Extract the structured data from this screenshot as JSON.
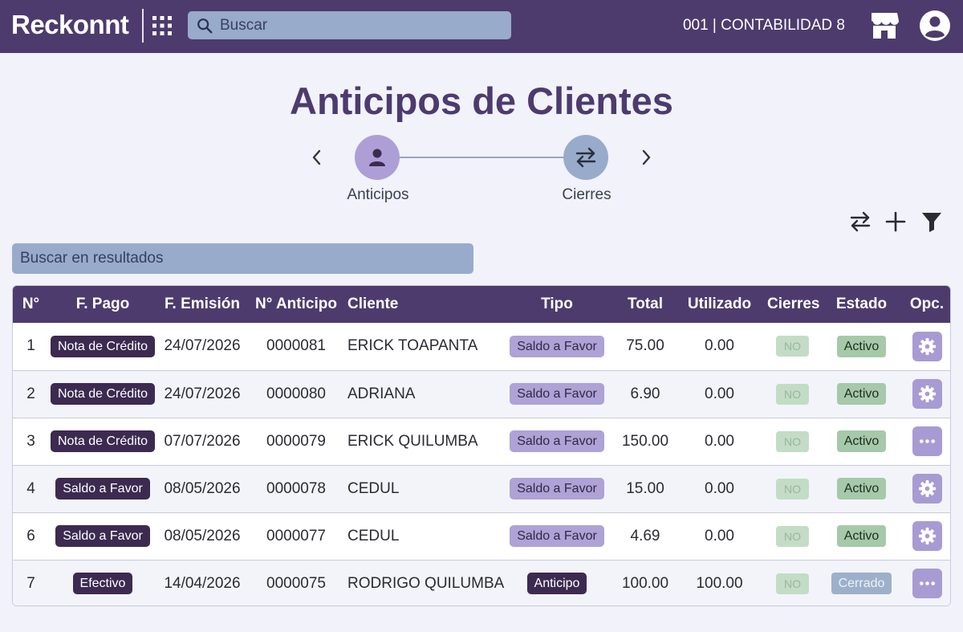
{
  "header": {
    "brand": "Reckonnt",
    "search_placeholder": "Buscar",
    "company": "001 | CONTABILIDAD 8"
  },
  "page": {
    "title": "Anticipos de Clientes"
  },
  "stepper": {
    "steps": [
      {
        "label": "Anticipos",
        "icon": "person-icon"
      },
      {
        "label": "Cierres",
        "icon": "swap-icon"
      }
    ]
  },
  "toolbar": {
    "icons": [
      "swap-icon",
      "plus-icon",
      "filter-icon"
    ]
  },
  "results_search": {
    "placeholder": "Buscar en resultados"
  },
  "table": {
    "columns": [
      "N°",
      "F. Pago",
      "F. Emisión",
      "N° Anticipo",
      "Cliente",
      "Tipo",
      "Total",
      "Utilizado",
      "Cierres",
      "Estado",
      "Opc."
    ],
    "rows": [
      {
        "n": "1",
        "pago": "Nota de Crédito",
        "emision": "24/07/2026",
        "anticipo": "0000081",
        "cliente": "ERICK TOAPANTA",
        "tipo": "Saldo a Favor",
        "total": "75.00",
        "utilizado": "0.00",
        "cierres": "NO",
        "estado": "Activo",
        "opc": "gear-icon"
      },
      {
        "n": "2",
        "pago": "Nota de Crédito",
        "emision": "24/07/2026",
        "anticipo": "0000080",
        "cliente": "ADRIANA",
        "tipo": "Saldo a Favor",
        "total": "6.90",
        "utilizado": "0.00",
        "cierres": "NO",
        "estado": "Activo",
        "opc": "gear-icon"
      },
      {
        "n": "3",
        "pago": "Nota de Crédito",
        "emision": "07/07/2026",
        "anticipo": "0000079",
        "cliente": "ERICK QUILUMBA",
        "tipo": "Saldo a Favor",
        "total": "150.00",
        "utilizado": "0.00",
        "cierres": "NO",
        "estado": "Activo",
        "opc": "more-icon"
      },
      {
        "n": "4",
        "pago": "Saldo a Favor",
        "emision": "08/05/2026",
        "anticipo": "0000078",
        "cliente": "CEDUL",
        "tipo": "Saldo a Favor",
        "total": "15.00",
        "utilizado": "0.00",
        "cierres": "NO",
        "estado": "Activo",
        "opc": "gear-icon"
      },
      {
        "n": "6",
        "pago": "Saldo a Favor",
        "emision": "08/05/2026",
        "anticipo": "0000077",
        "cliente": "CEDUL",
        "tipo": "Saldo a Favor",
        "total": "4.69",
        "utilizado": "0.00",
        "cierres": "NO",
        "estado": "Activo",
        "opc": "gear-icon"
      },
      {
        "n": "7",
        "pago": "Efectivo",
        "emision": "14/04/2026",
        "anticipo": "0000075",
        "cliente": "RODRIGO QUILUMBA",
        "tipo": "Anticipo",
        "total": "100.00",
        "utilizado": "100.00",
        "cierres": "NO",
        "estado": "Cerrado",
        "opc": "more-icon"
      }
    ]
  },
  "colors": {
    "header_bg": "#4d3b6e",
    "search_bg": "#98abcb",
    "badge_dark": "#3c2a50",
    "badge_tipo": "#aea2d6",
    "status_active": "#a6c9a9",
    "status_closed": "#9db0ca",
    "option_button": "#a89bd4"
  }
}
